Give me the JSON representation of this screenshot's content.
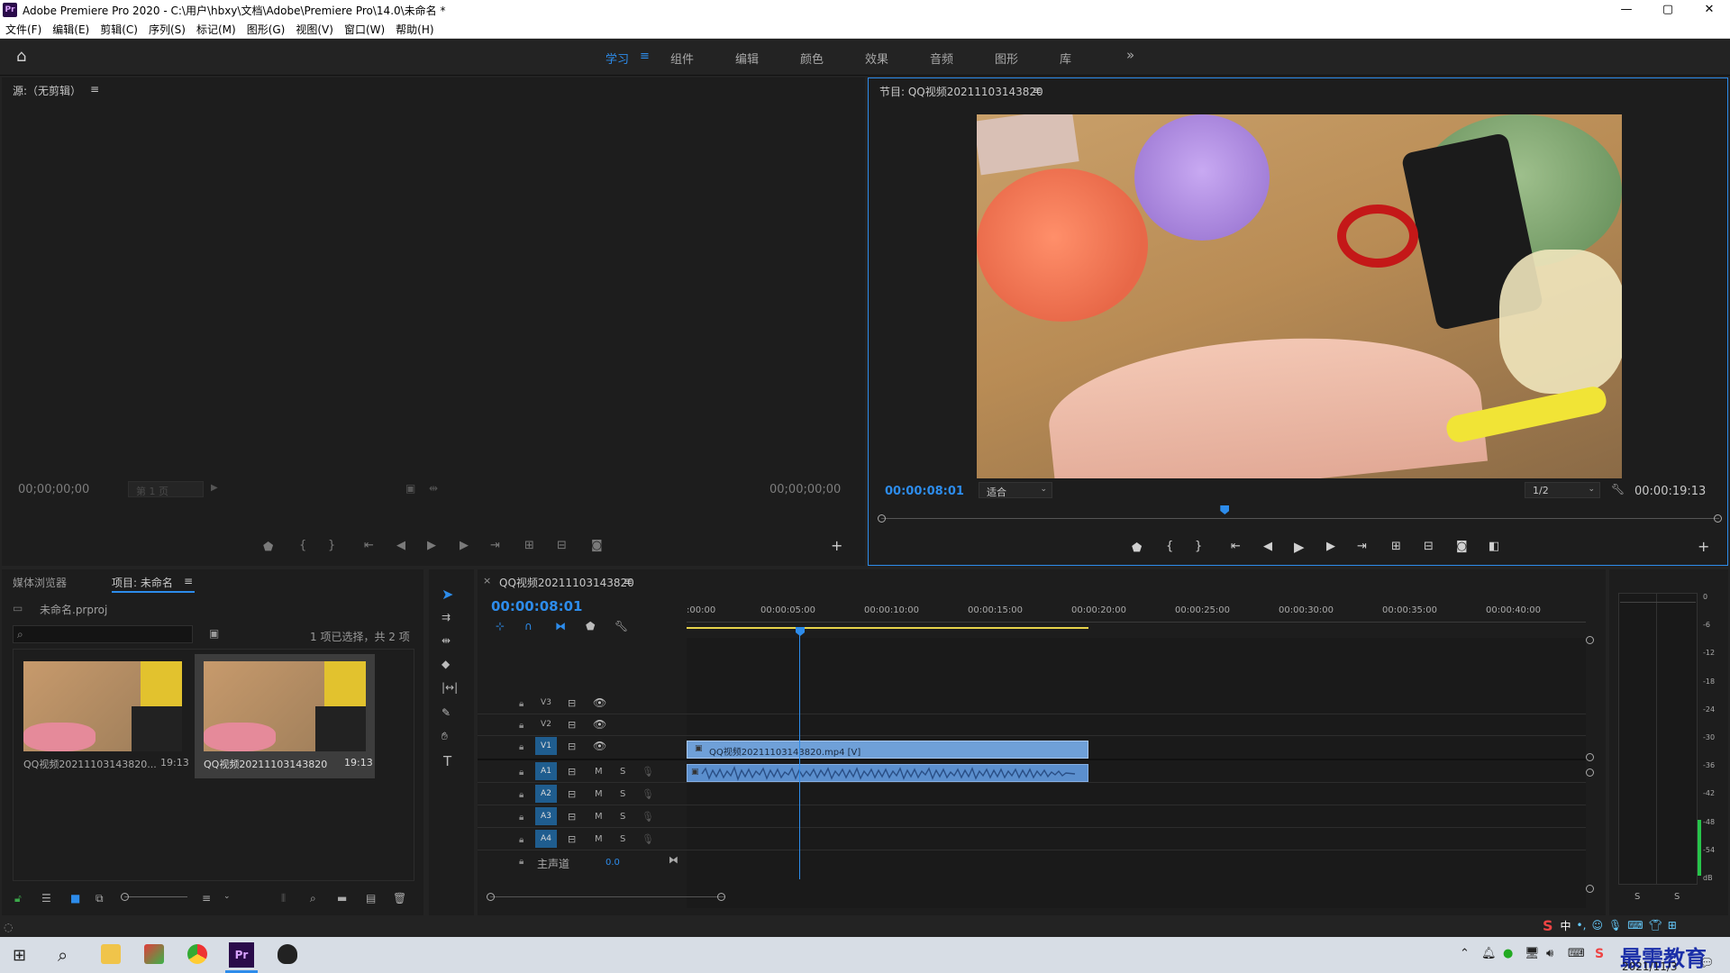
{
  "window": {
    "title": "Adobe Premiere Pro 2020 - C:\\用户\\hbxy\\文档\\Adobe\\Premiere Pro\\14.0\\未命名 *",
    "logo": "Pr",
    "min": "—",
    "max": "▢",
    "close": "✕"
  },
  "menu": [
    "文件(F)",
    "编辑(E)",
    "剪辑(C)",
    "序列(S)",
    "标记(M)",
    "图形(G)",
    "视图(V)",
    "窗口(W)",
    "帮助(H)"
  ],
  "workspaces": {
    "items": [
      "学习",
      "组件",
      "编辑",
      "颜色",
      "效果",
      "音频",
      "图形",
      "库"
    ],
    "active_menu": "≡",
    "overflow": "»"
  },
  "source": {
    "title": "源:（无剪辑）",
    "menu": "≡",
    "tc_in": "00;00;00;00",
    "tc_out": "00;00;00;00",
    "page": "第 1 页",
    "add": "+"
  },
  "program": {
    "title": "节目: QQ视频20211103143820",
    "menu": "≡",
    "tc_current": "00:00:08:01",
    "tc_duration": "00:00:19:13",
    "fit": "适合",
    "resolution": "1/2",
    "playhead_fraction": 0.41,
    "add": "+"
  },
  "project": {
    "tab_media": "媒体浏览器",
    "tab_project": "项目: 未命名",
    "menu": "≡",
    "file": "未命名.prproj",
    "selection": "1 项已选择，共 2 项",
    "items": [
      {
        "name": "QQ视频20211103143820...",
        "duration": "19:13"
      },
      {
        "name": "QQ视频20211103143820",
        "duration": "19:13"
      }
    ]
  },
  "timeline": {
    "close": "×",
    "title": "QQ视频20211103143820",
    "menu": "≡",
    "timecode": "00:00:08:01",
    "ruler": [
      ":00:00",
      "00:00:05:00",
      "00:00:10:00",
      "00:00:15:00",
      "00:00:20:00",
      "00:00:25:00",
      "00:00:30:00",
      "00:00:35:00",
      "00:00:40:00"
    ],
    "video_tracks": [
      "V3",
      "V2",
      "V1"
    ],
    "audio_tracks": [
      "A1",
      "A2",
      "A3",
      "A4"
    ],
    "master": "主声道",
    "master_value": "0.0",
    "clip_label": "QQ视频20211103143820.mp4 [V]",
    "mute": "M",
    "solo": "S"
  },
  "meter": {
    "scale": [
      "0",
      "-6",
      "-12",
      "-18",
      "-24",
      "-30",
      "-36",
      "-42",
      "-48",
      "-54",
      "dB"
    ],
    "solo_left": "S",
    "solo_right": "S",
    "level_fraction": 0.2
  },
  "taskbar": {
    "date": "2021/11/3",
    "watermark": "最需教育",
    "ime": "中"
  },
  "colors": {
    "accent": "#2d8ceb",
    "clip_video": "#6fa0d8",
    "clip_audio": "#5b8fce",
    "work_area": "#e7d34a"
  }
}
